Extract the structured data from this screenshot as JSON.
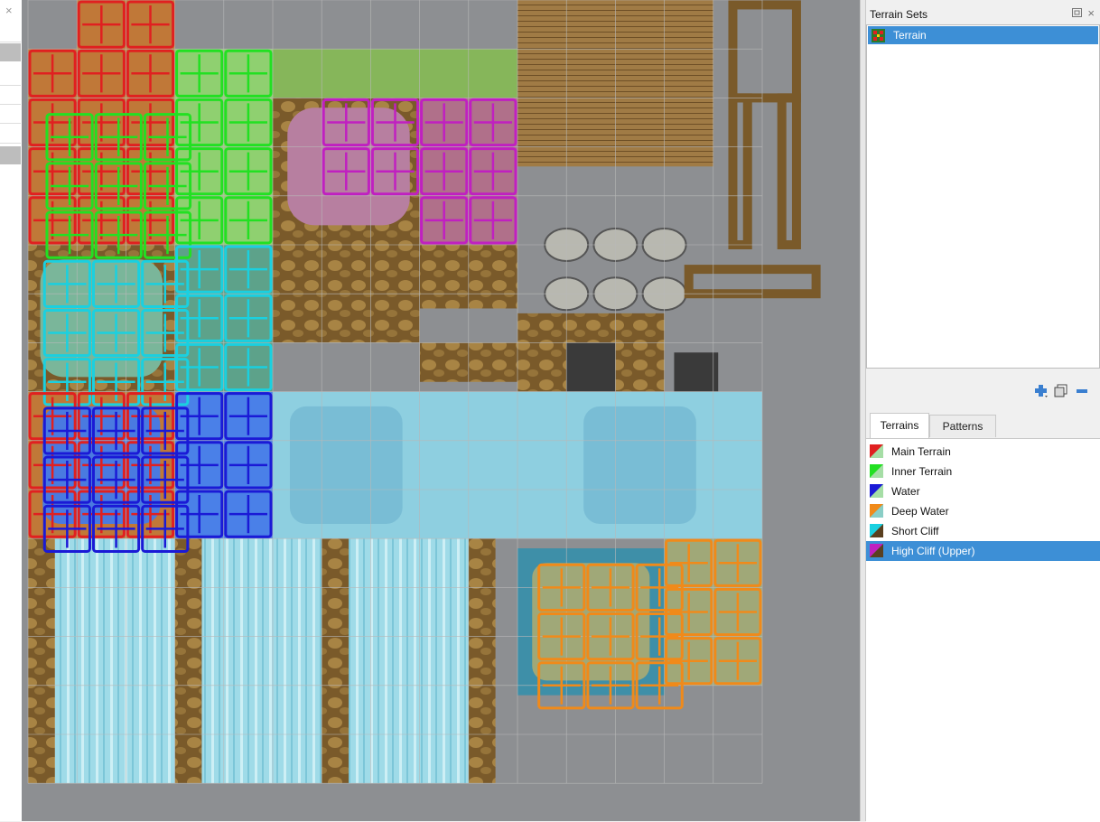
{
  "left_strip": {
    "close_glyph": "×"
  },
  "terrain_sets": {
    "title": "Terrain Sets",
    "items": [
      {
        "label": "Terrain",
        "icon": "terrain-set-icon",
        "selected": true
      }
    ]
  },
  "toolbar": {
    "icons": [
      "add-terrain-icon",
      "duplicate-icon",
      "remove-icon"
    ]
  },
  "tabs": [
    {
      "label": "Terrains",
      "active": true
    },
    {
      "label": "Patterns",
      "active": false
    }
  ],
  "terrains": [
    {
      "label": "Main Terrain",
      "color": "#e02020",
      "selected": false
    },
    {
      "label": "Inner Terrain",
      "color": "#22e022",
      "selected": false
    },
    {
      "label": "Water",
      "color": "#1a1ad6",
      "selected": false
    },
    {
      "label": "Deep Water",
      "color": "#f08a1a",
      "selected": false
    },
    {
      "label": "Short Cliff",
      "color": "#1ad0e0",
      "selected": false
    },
    {
      "label": "High Cliff (Upper)",
      "color": "#c020c0",
      "selected": true
    }
  ],
  "colors": {
    "selection": "#3d8fd6",
    "main_terrain": "#e02020",
    "inner_terrain": "#22e022",
    "water": "#1a1ad6",
    "deep_water": "#f08a1a",
    "short_cliff": "#1ad0e0",
    "high_cliff": "#c020c0"
  }
}
